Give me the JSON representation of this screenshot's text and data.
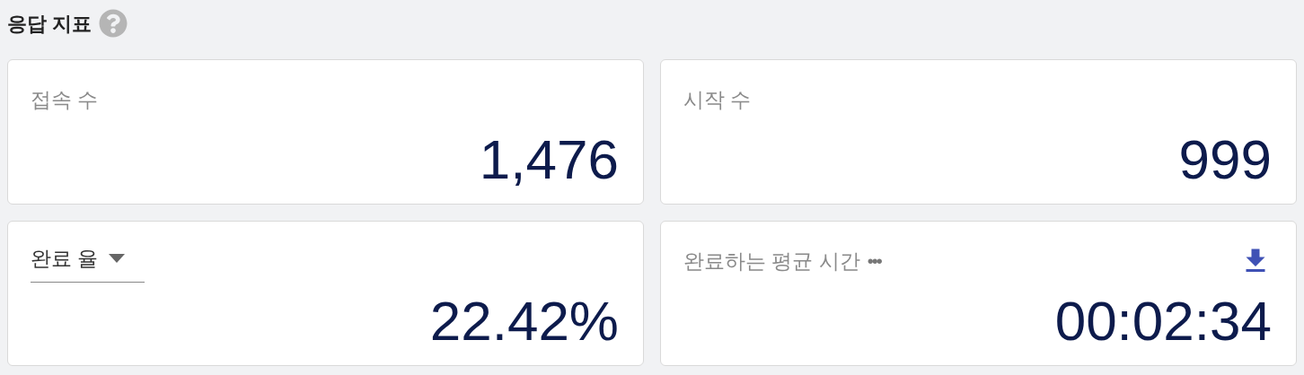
{
  "title": "응답 지표",
  "cards": [
    {
      "kind": "stat",
      "label": "접속 수",
      "value": "1,476"
    },
    {
      "kind": "stat",
      "label": "시작 수",
      "value": "999"
    },
    {
      "kind": "select",
      "label": "완료 율",
      "value": "22.42%"
    },
    {
      "kind": "stat",
      "label": "완료하는 평균 시간",
      "more": "•••",
      "download": true,
      "value": "00:02:34"
    }
  ]
}
